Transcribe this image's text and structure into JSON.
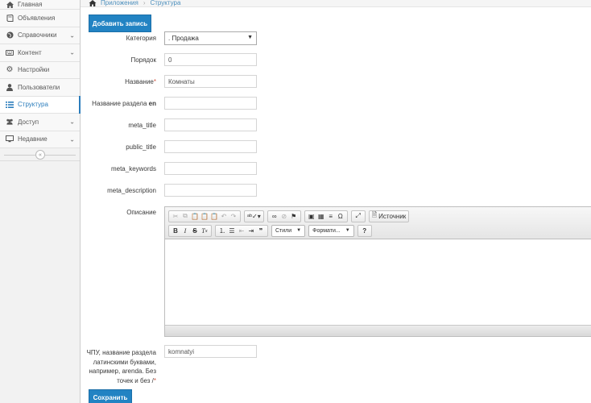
{
  "sidebar": {
    "items": [
      {
        "label": "Главная",
        "icon": "home-icon",
        "has_submenu": false,
        "active": false
      },
      {
        "label": "Объявления",
        "icon": "book-icon",
        "has_submenu": false,
        "active": false
      },
      {
        "label": "Справочники",
        "icon": "globe-icon",
        "has_submenu": true,
        "active": false
      },
      {
        "label": "Контент",
        "icon": "keyboard-icon",
        "has_submenu": true,
        "active": false
      },
      {
        "label": "Настройки",
        "icon": "cog-icon",
        "has_submenu": false,
        "active": false
      },
      {
        "label": "Пользователи",
        "icon": "user-icon",
        "has_submenu": false,
        "active": false
      },
      {
        "label": "Структура",
        "icon": "list-icon",
        "has_submenu": false,
        "active": true
      },
      {
        "label": "Доступ",
        "icon": "users-icon",
        "has_submenu": true,
        "active": false
      },
      {
        "label": "Недавние",
        "icon": "desktop-icon",
        "has_submenu": true,
        "active": false
      }
    ],
    "accent_color": "#2b7dbc"
  },
  "breadcrumb": {
    "home_icon": "home-icon",
    "items": [
      "Приложения",
      "Структура"
    ]
  },
  "form": {
    "add_button_label": "Добавить запись",
    "category": {
      "label": "Категория",
      "value": ". Продажа"
    },
    "order": {
      "label": "Порядок",
      "value": "0"
    },
    "name": {
      "label": "Название",
      "required_mark": "*",
      "value": "Комнаты"
    },
    "name_en": {
      "label": "Название раздела",
      "lang": "en",
      "value": ""
    },
    "meta_title": {
      "label": "meta_title",
      "value": ""
    },
    "public_title": {
      "label": "public_title",
      "value": ""
    },
    "meta_keywords": {
      "label": "meta_keywords",
      "value": ""
    },
    "meta_description": {
      "label": "meta_description",
      "value": ""
    },
    "description": {
      "label": "Описание",
      "toolbar": {
        "source_label": "Источник",
        "styles_label": "Стили",
        "format_label": "Формати...",
        "help_label": "?"
      }
    },
    "slug": {
      "label_lines": [
        "ЧПУ, название раздела",
        "латинскими буквами,",
        "например, arenda. Без",
        "точек и без /"
      ],
      "required_mark": "*",
      "value": "komnatyi"
    },
    "save_button_label": "Сохранить"
  },
  "colors": {
    "primary_button": "#2283c3",
    "required": "#d15b47",
    "link": "#4c8fbd"
  }
}
